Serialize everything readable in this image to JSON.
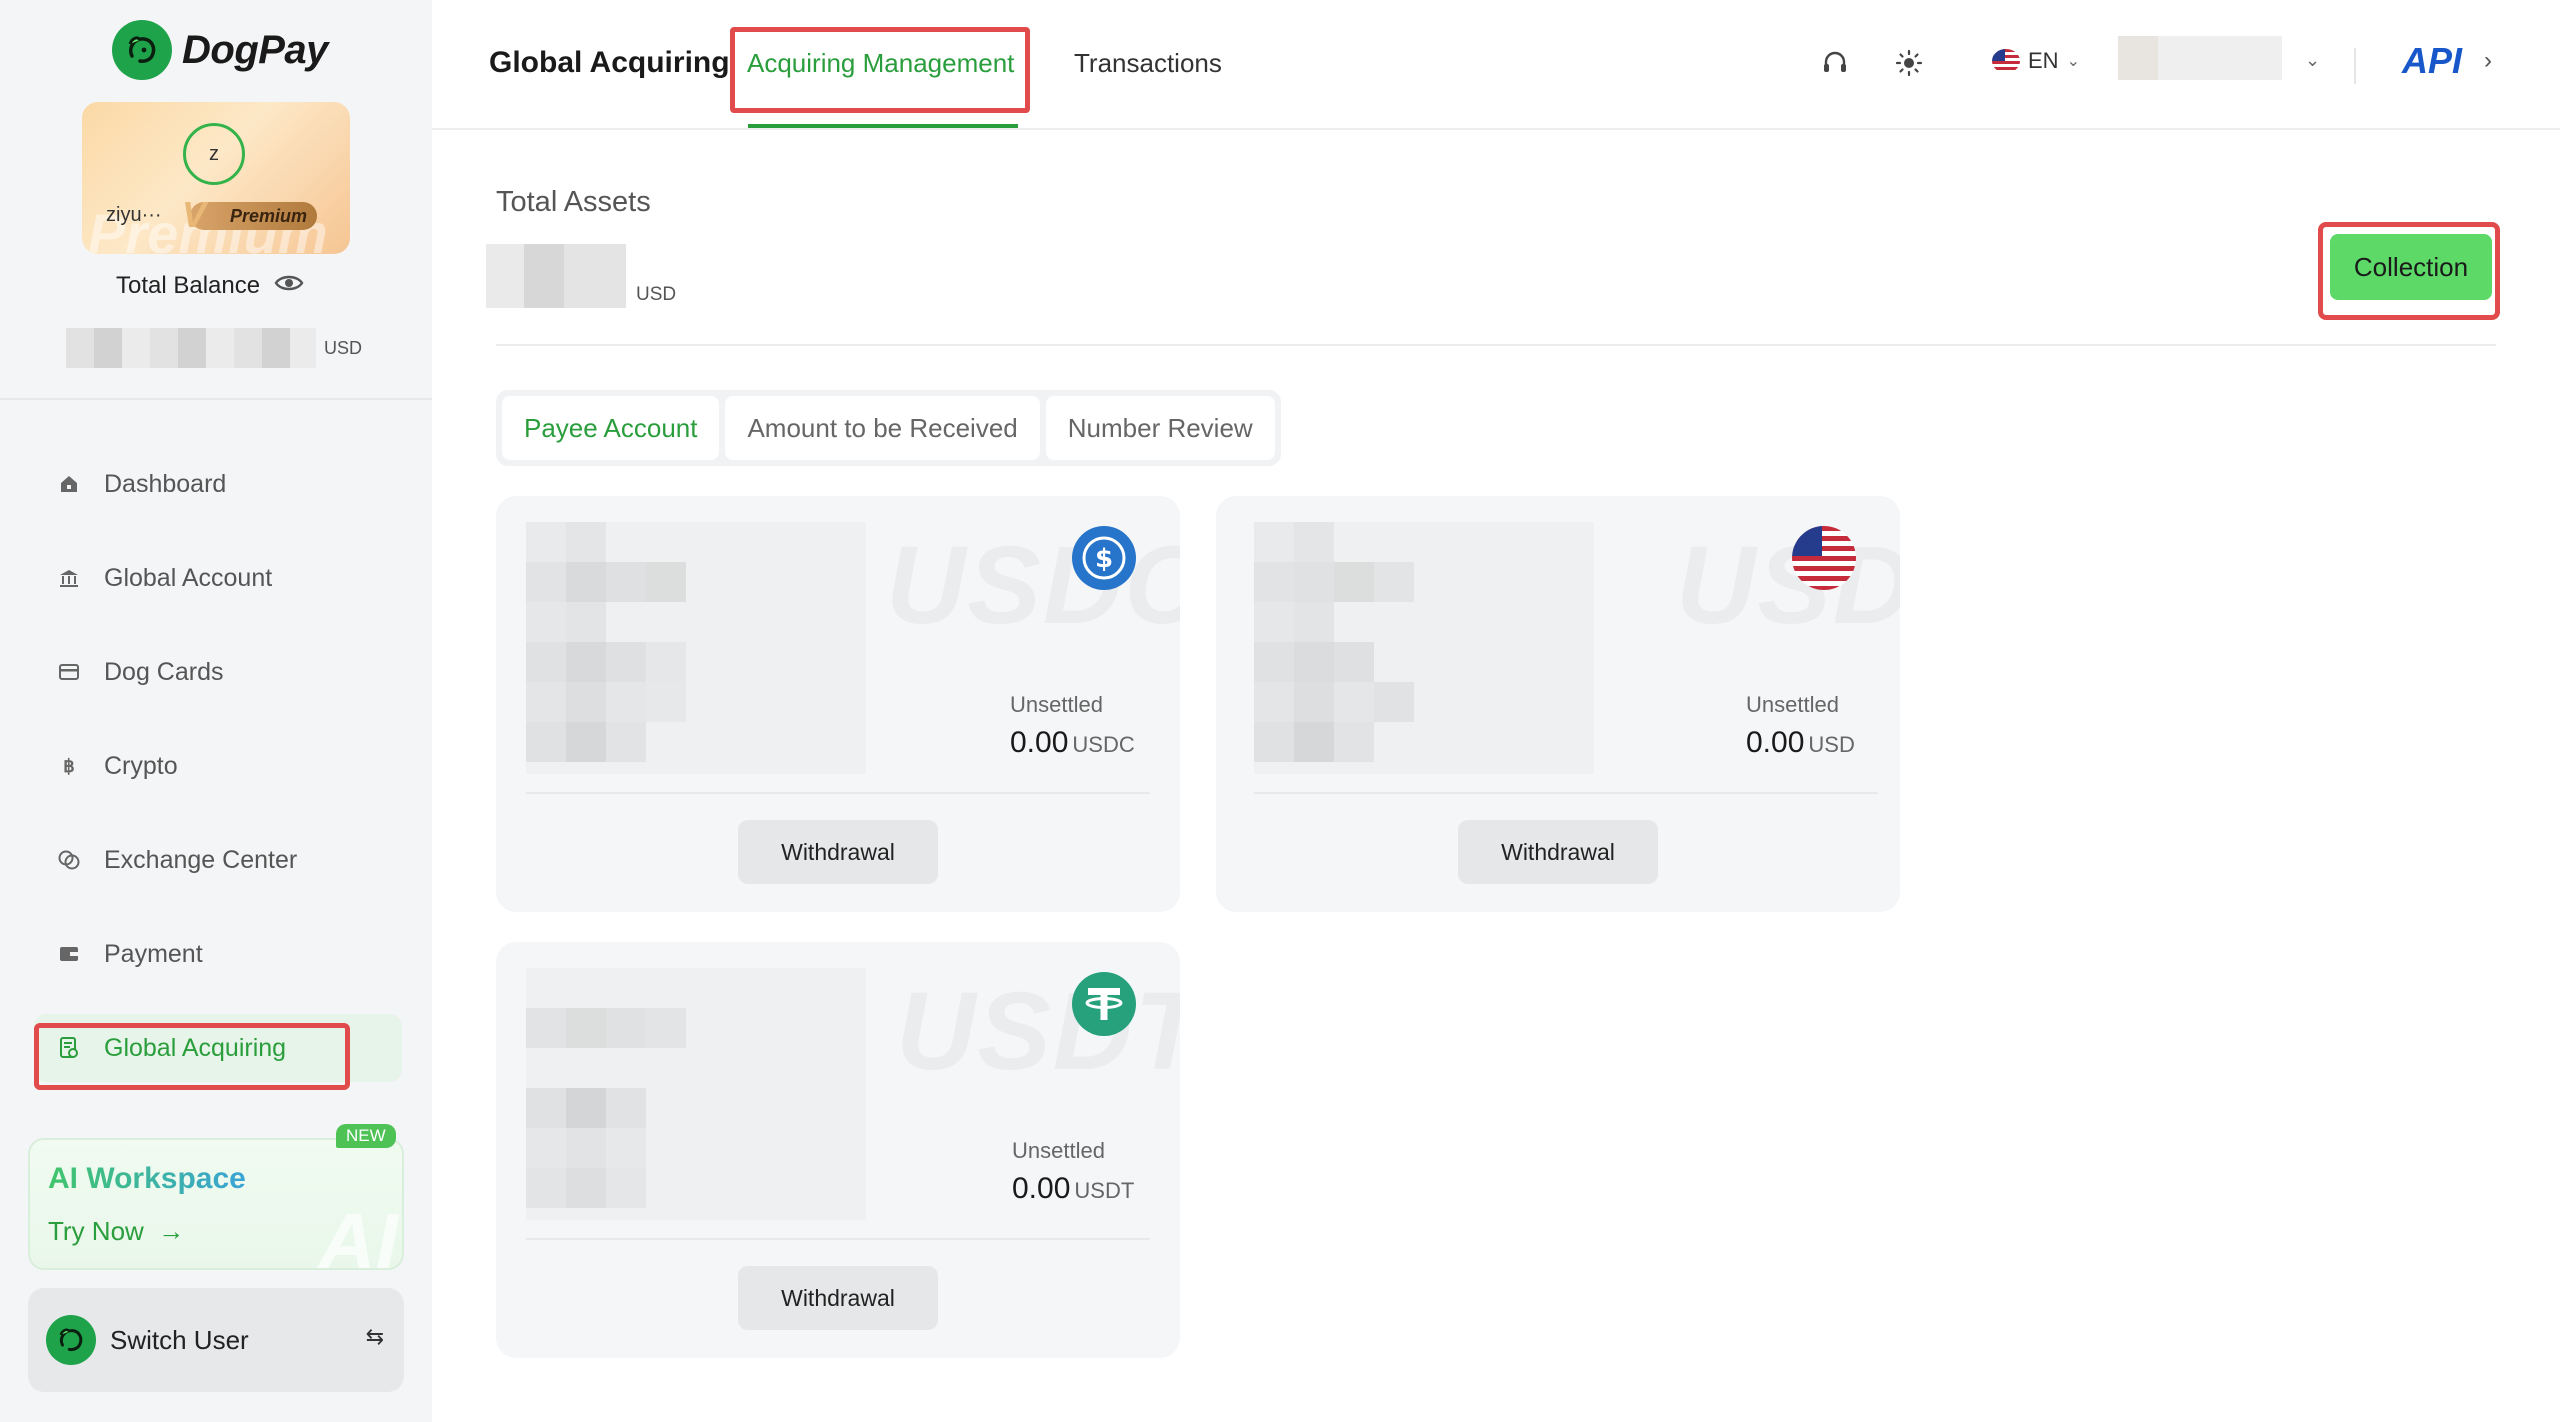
{
  "brand": {
    "name": "DogPay"
  },
  "profile": {
    "avatar_letter": "z",
    "username": "ziyu···",
    "tier": "Premium",
    "total_balance_label": "Total Balance",
    "balance_unit": "USD"
  },
  "nav": {
    "items": [
      {
        "label": "Dashboard",
        "icon": "home-icon"
      },
      {
        "label": "Global Account",
        "icon": "bank-icon"
      },
      {
        "label": "Dog Cards",
        "icon": "card-icon"
      },
      {
        "label": "Crypto",
        "icon": "bitcoin-icon"
      },
      {
        "label": "Exchange Center",
        "icon": "exchange-icon"
      },
      {
        "label": "Payment",
        "icon": "wallet-icon"
      },
      {
        "label": "Global Acquiring",
        "icon": "acquiring-icon",
        "active": true
      }
    ]
  },
  "ai_promo": {
    "badge": "NEW",
    "title": "AI Workspace",
    "cta": "Try Now",
    "watermark": "AI"
  },
  "switch_user": {
    "label": "Switch User"
  },
  "header": {
    "title": "Global Acquiring",
    "tabs": [
      {
        "label": "Acquiring Management",
        "active": true
      },
      {
        "label": "Transactions"
      }
    ],
    "language": "EN",
    "api_label": "API"
  },
  "assets": {
    "label": "Total Assets",
    "unit": "USD",
    "collection_button": "Collection"
  },
  "subtabs": [
    {
      "label": "Payee Account",
      "active": true
    },
    {
      "label": "Amount to be Received"
    },
    {
      "label": "Number Review"
    }
  ],
  "accounts": [
    {
      "watermark": "USDC",
      "icon": "usdc-icon",
      "unsettled_label": "Unsettled",
      "amount": "0.00",
      "currency": "USDC",
      "button": "Withdrawal"
    },
    {
      "watermark": "USD",
      "icon": "us-flag-icon",
      "unsettled_label": "Unsettled",
      "amount": "0.00",
      "currency": "USD",
      "button": "Withdrawal"
    },
    {
      "watermark": "USDT",
      "icon": "tether-icon",
      "unsettled_label": "Unsettled",
      "amount": "0.00",
      "currency": "USDT",
      "button": "Withdrawal"
    }
  ],
  "colors": {
    "accent_green": "#2a9e3c",
    "collection_button": "#5cd966",
    "highlight_red": "#e24b4b",
    "api_blue": "#1757c9",
    "usdc_blue": "#2775ca",
    "tether_green": "#26a17b"
  }
}
